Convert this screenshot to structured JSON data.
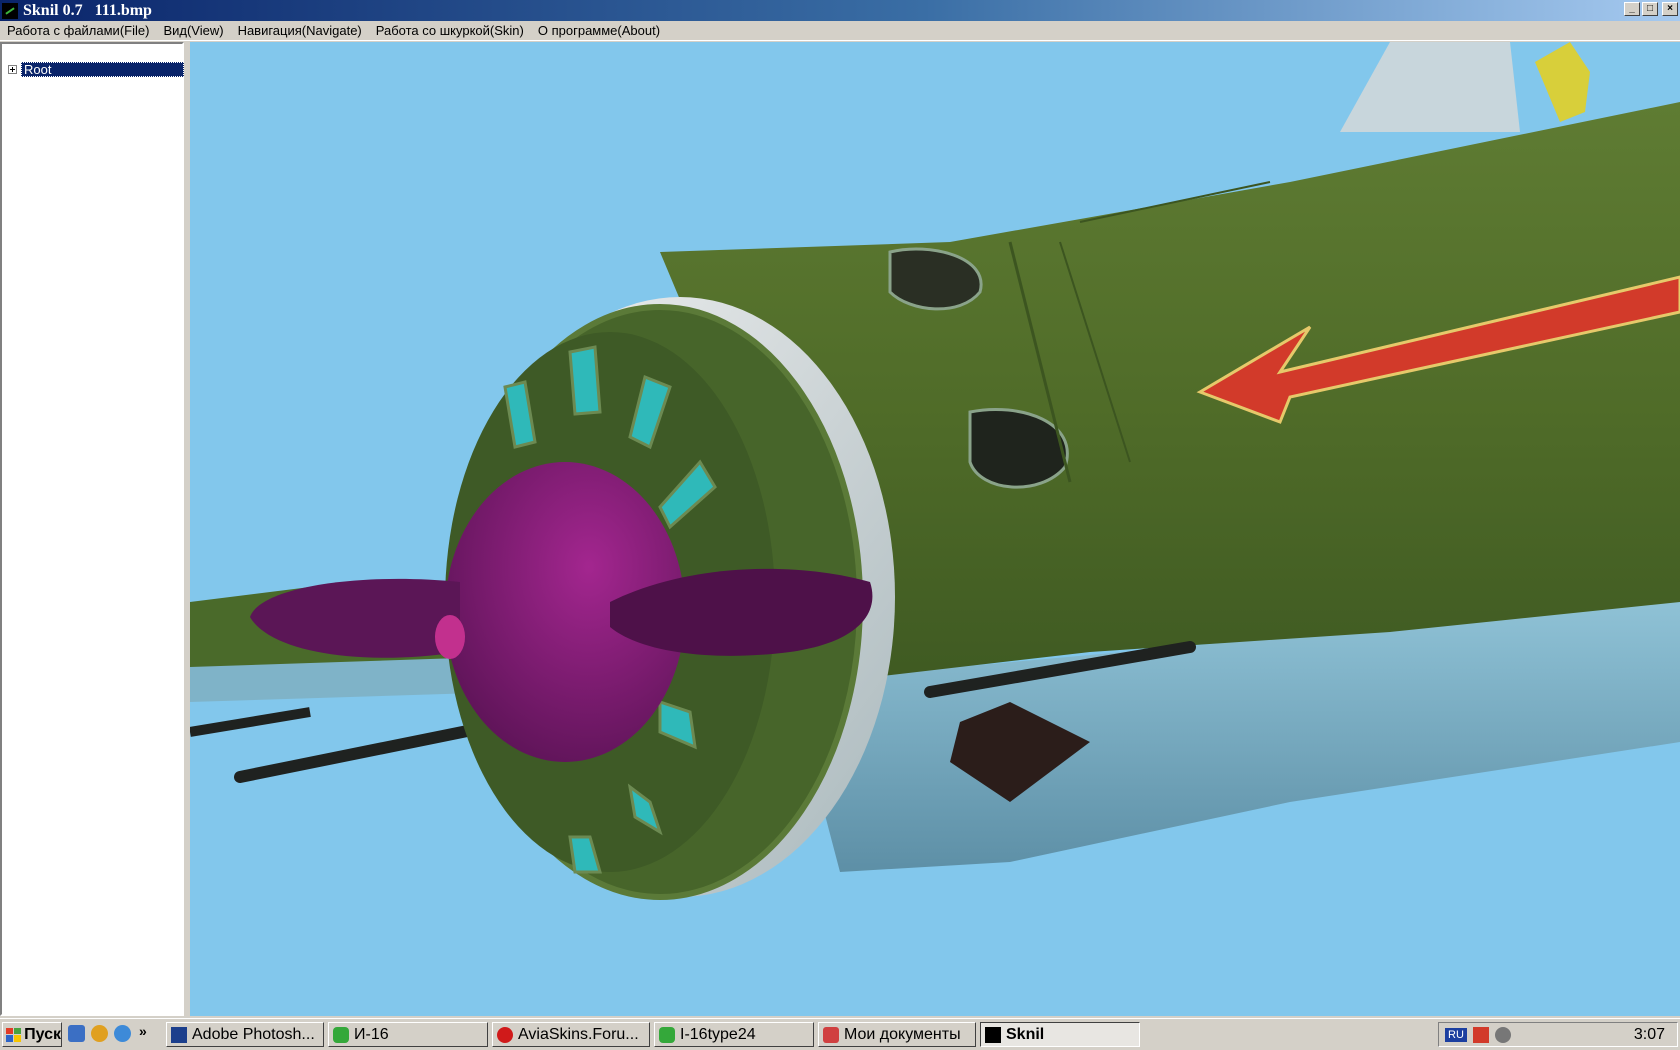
{
  "window": {
    "title": "Sknil 0.7   111.bmp",
    "app_icon": "sknil-app-icon",
    "controls": {
      "minimize": "_",
      "maximize": "□",
      "close": "×"
    }
  },
  "menu": {
    "items": [
      {
        "label": "Работа с файлами(File)"
      },
      {
        "label": "Вид(View)"
      },
      {
        "label": "Навигация(Navigate)"
      },
      {
        "label": "Работа со шкуркой(Skin)"
      },
      {
        "label": "О программе(About)"
      }
    ]
  },
  "tree": {
    "root_label": "Root",
    "expander_icon": "plus-expander-icon"
  },
  "viewport": {
    "content": "3d-aircraft-model-render",
    "colors": {
      "sky": "#82c7ec",
      "fuselage": "#56712e",
      "underside": "#7fb3c8",
      "propeller": "#5b1656",
      "spinner": "#8a1f7d",
      "cowl_vents": "#2fb9b9",
      "star_arrow": "#d23a2a"
    }
  },
  "taskbar": {
    "start_label": "Пуск",
    "quick_launch": [
      "show-desktop-icon",
      "media-icon",
      "browser-icon"
    ],
    "chevron": "»",
    "tasks": [
      {
        "label": "Adobe Photosh...",
        "icon": "photoshop-icon",
        "active": false
      },
      {
        "label": "И-16",
        "icon": "chat-icon",
        "active": false
      },
      {
        "label": "AviaSkins.Foru...",
        "icon": "opera-icon",
        "active": false
      },
      {
        "label": "I-16type24",
        "icon": "chat-icon",
        "active": false
      },
      {
        "label": "Мои документы",
        "icon": "folder-icon",
        "active": false
      },
      {
        "label": "Sknil",
        "icon": "sknil-app-icon",
        "active": true
      }
    ],
    "tray": {
      "language": "RU",
      "icons": [
        "network-warning-icon",
        "volume-icon"
      ],
      "clock": "3:07"
    }
  }
}
